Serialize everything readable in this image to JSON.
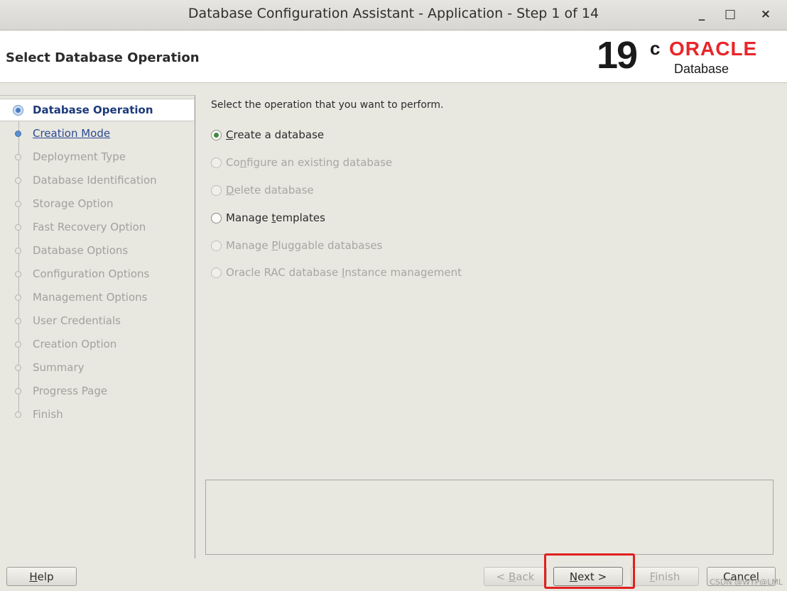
{
  "window": {
    "title": "Database Configuration Assistant - Application - Step 1 of 14",
    "minimize_glyph": "_",
    "maximize_glyph": "□",
    "close_glyph": "×"
  },
  "header": {
    "page_title": "Select Database Operation",
    "logo": {
      "version": "19",
      "version_suffix": "c",
      "brand": "ORACLE",
      "product": "Database",
      "brand_color": "#e8252a"
    }
  },
  "nav": {
    "steps": [
      {
        "label": "Database Operation",
        "state": "active"
      },
      {
        "label": "Creation Mode",
        "state": "link"
      },
      {
        "label": "Deployment Type",
        "state": "disabled"
      },
      {
        "label": "Database Identification",
        "state": "disabled"
      },
      {
        "label": "Storage Option",
        "state": "disabled"
      },
      {
        "label": "Fast Recovery Option",
        "state": "disabled"
      },
      {
        "label": "Database Options",
        "state": "disabled"
      },
      {
        "label": "Configuration Options",
        "state": "disabled"
      },
      {
        "label": "Management Options",
        "state": "disabled"
      },
      {
        "label": "User Credentials",
        "state": "disabled"
      },
      {
        "label": "Creation Option",
        "state": "disabled"
      },
      {
        "label": "Summary",
        "state": "disabled"
      },
      {
        "label": "Progress Page",
        "state": "disabled"
      },
      {
        "label": "Finish",
        "state": "disabled"
      }
    ]
  },
  "main": {
    "prompt": "Select the operation that you want to perform.",
    "options": [
      {
        "mnemonic": "C",
        "rest": "reate a database",
        "selected": true,
        "enabled": true
      },
      {
        "pre": "Co",
        "mnemonic": "n",
        "rest": "figure an existing database",
        "selected": false,
        "enabled": false
      },
      {
        "mnemonic": "D",
        "rest": "elete database",
        "selected": false,
        "enabled": false
      },
      {
        "pre": "Manage ",
        "mnemonic": "t",
        "rest": "emplates",
        "selected": false,
        "enabled": true
      },
      {
        "pre": "Manage ",
        "mnemonic": "P",
        "rest": "luggable databases",
        "selected": false,
        "enabled": false
      },
      {
        "pre": "Oracle RAC database ",
        "mnemonic": "I",
        "rest": "nstance management",
        "selected": false,
        "enabled": false
      }
    ]
  },
  "buttons": {
    "help": {
      "mnemonic": "H",
      "rest": "elp"
    },
    "back": {
      "pre": "< ",
      "mnemonic": "B",
      "rest": "ack"
    },
    "next": {
      "mnemonic": "N",
      "rest": "ext >"
    },
    "finish": {
      "mnemonic": "F",
      "rest": "inish"
    },
    "cancel": "Cancel"
  },
  "watermark": "CSDN @WYP@LML",
  "colors": {
    "highlight": "#e0201e",
    "active_step": "#1d3a7a",
    "link_step": "#2b4a94"
  }
}
